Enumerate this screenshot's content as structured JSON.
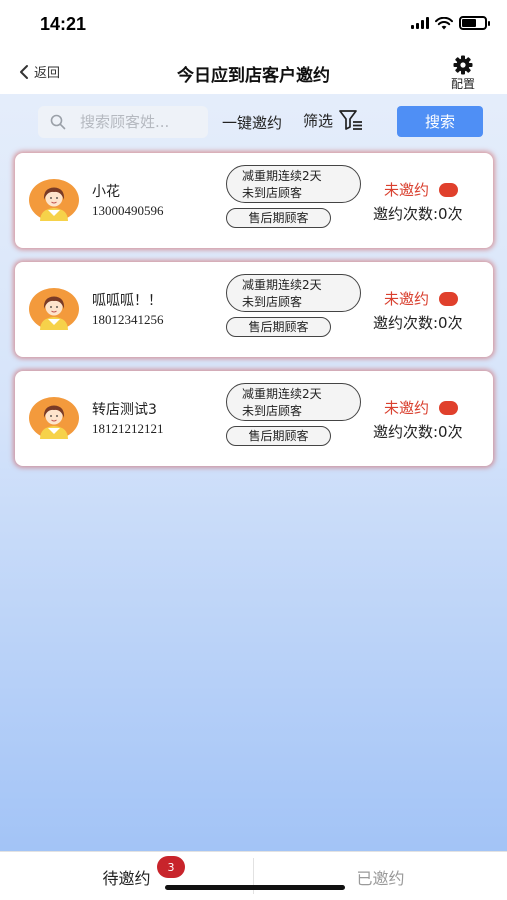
{
  "status_bar": {
    "time": "14:21"
  },
  "nav": {
    "back_label": "返回",
    "title": "今日应到店客户邀约",
    "config_label": "配置"
  },
  "toolbar": {
    "search_placeholder": "搜索顾客姓...",
    "search_value": "",
    "one_key_label": "一键邀约",
    "filter_label": "筛选",
    "search_button_label": "搜索"
  },
  "customers": [
    {
      "name": "小花",
      "phone": "13000490596",
      "tag_line1": "减重期连续2天",
      "tag_line2": "未到店顾客",
      "tag_small": "售后期顾客",
      "status": "未邀约",
      "invite_count": "邀约次数:0次"
    },
    {
      "name": "呱呱呱！！",
      "phone": "18012341256",
      "tag_line1": "减重期连续2天",
      "tag_line2": "未到店顾客",
      "tag_small": "售后期顾客",
      "status": "未邀约",
      "invite_count": "邀约次数:0次"
    },
    {
      "name": "转店测试3",
      "phone": "18121212121",
      "tag_line1": "减重期连续2天",
      "tag_line2": "未到店顾客",
      "tag_small": "售后期顾客",
      "status": "未邀约",
      "invite_count": "邀约次数:0次"
    }
  ],
  "tabs": {
    "pending_label": "待邀约",
    "pending_badge": "3",
    "done_label": "已邀约"
  },
  "colors": {
    "accent": "#4f8ff5",
    "status_red": "#d9402f",
    "badge_red": "#c8242b"
  },
  "icons": {
    "back": "chevron-left-icon",
    "config": "gear-icon",
    "search": "search-icon",
    "filter": "filter-icon",
    "avatar": "avatar-icon"
  }
}
